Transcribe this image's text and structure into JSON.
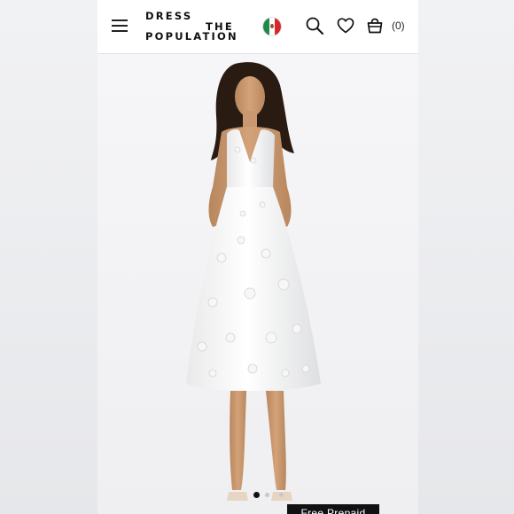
{
  "brand": {
    "line1": "DRESS",
    "line2": "THE",
    "line3": "POPULATION"
  },
  "header": {
    "cart_count": "(0)",
    "country_flag": "mexico-flag-icon"
  },
  "icons": [
    "menu-icon",
    "search-icon",
    "heart-icon",
    "shopping-bag-icon"
  ],
  "hero": {
    "image": "white floral lace midi dress on model",
    "carousel_active_index": 0,
    "carousel_count": 3
  },
  "cta": {
    "label": "Free Prepaid"
  },
  "colors": {
    "header_bg": "#ffffff",
    "page_bg": "#ecedef",
    "cta_bg": "#111111",
    "dress": "#ffffff"
  }
}
